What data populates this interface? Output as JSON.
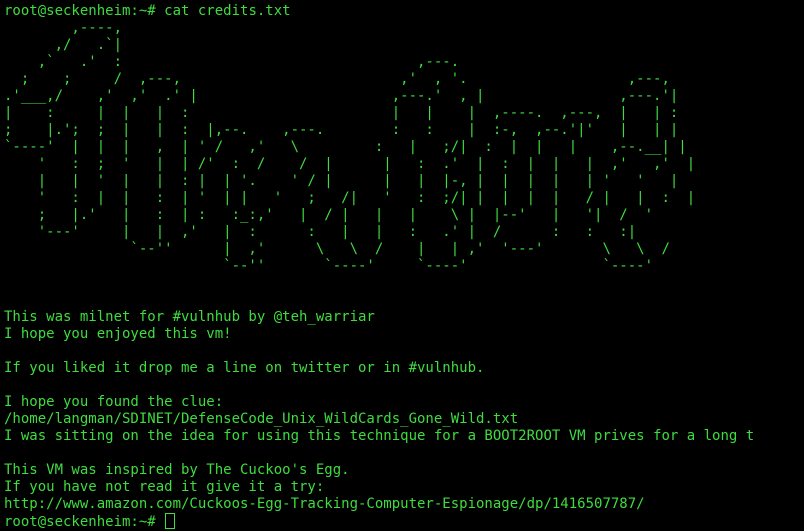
{
  "terminal": {
    "text_color": "#3fdc3f",
    "background_color": "#000000",
    "prompt": "root@seckenheim:~#",
    "command": "cat credits.txt",
    "banner_art": "        ,----,\n      ,/   .`|\n    ,`   .'  :                                   ,---.\n  ;    ;     /  ,---,                          ,'  , '.                   ,---,\n.'___,/    ,'  ,'  .' |                       ,---.'  , |                ,---.'|\n|    :     |  |   |  :                        |   |    |  ,----.  ,---,  |   | :\n;    |.';  ;  |   |  :  |,--.    ,---.        :   :    |  :-,  ,--.'|'   |   | |\n`----'  |  |  |   ,  | ' /   ,'   \\         :   |   ;/|  :  |  |   |    ,--.__| |\n    '   :  ;  '   |  | /'  :  /    /  |      |   :  .'  |  :  |  |   |  ,'   ,'  |\n    |   |  '  |   |  : |  | '.    ' / |      |   |  |-, |  |  |  |   | '   '   |\n    '   :  |  |   :  | '  | |   '   ;   /|   '   :  ;/| |  |  |  |   / |   |  :  |\n    ;   |.'   |   :  | :   :_:,'   |  / |   |   |    \\ |  |--'   |   '|  /  '\n    '---'     |   |  ,'   |  :      :   |   |   :   .' |  /      :   :   :|\n               `--''      |  ,'      \\   \\  /    |   | ,'  '---'       \\   \\  /\n                          `--''       `----'     `----'                `----'",
    "output_lines": [
      "This was milnet for #vulnhub by @teh_warriar",
      "I hope you enjoyed this vm!",
      "If you liked it drop me a line on twitter or in #vulnhub.",
      "I hope you found the clue:",
      "/home/langman/SDINET/DefenseCode_Unix_WildCards_Gone_Wild.txt",
      "I was sitting on the idea for using this technique for a BOOT2ROOT VM prives for a long t",
      "This VM was inspired by The Cuckoo's Egg.",
      "If you have not read it give it a try:",
      "http://www.amazon.com/Cuckoos-Egg-Tracking-Computer-Espionage/dp/1416507787/"
    ]
  }
}
